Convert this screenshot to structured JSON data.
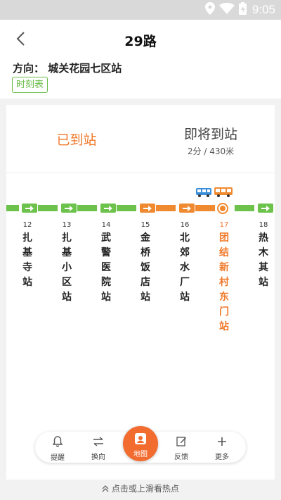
{
  "status_bar": {
    "time": "9:05"
  },
  "header": {
    "title": "29路"
  },
  "direction": {
    "label": "方向：",
    "destination": "城关花园七区站"
  },
  "timetable_label": "时刻表",
  "tabs": {
    "arrived": "已到站",
    "coming": "即将到站",
    "coming_detail": "2分 / 430米"
  },
  "stops": [
    {
      "num": "12",
      "name": "扎基寺站"
    },
    {
      "num": "13",
      "name": "扎基小区站"
    },
    {
      "num": "14",
      "name": "武警医院站"
    },
    {
      "num": "15",
      "name": "金桥饭店站"
    },
    {
      "num": "16",
      "name": "北郊水厂站"
    },
    {
      "num": "17",
      "name": "团结新村东门站",
      "current": true
    },
    {
      "num": "18",
      "name": "热木其站"
    }
  ],
  "colors": {
    "accent": "#f07828",
    "line_green": "#6cc24a",
    "line_orange": "#f08a30",
    "bus_blue": "#3b8fd9",
    "bus_orange": "#f08a30"
  },
  "bottom_nav": {
    "remind": "提醒",
    "switch_direction": "换向",
    "map": "地图",
    "feedback": "反馈",
    "more": "更多"
  },
  "hint": "点击或上滑看热点"
}
